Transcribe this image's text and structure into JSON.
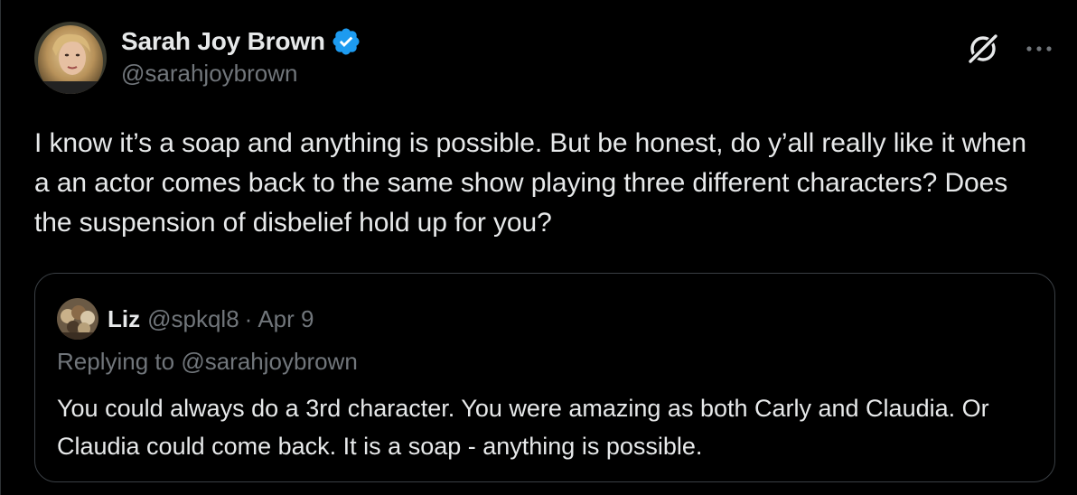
{
  "author": {
    "display_name": "Sarah Joy Brown",
    "handle": "@sarahjoybrown",
    "verified": true,
    "avatar_icon": "avatar-photo"
  },
  "tweet": {
    "text": "I know it’s a soap and anything is possible. But be honest, do y’all really like it when a an actor comes back to the same show playing three different characters? Does the suspension of disbelief hold up for you?"
  },
  "actions": {
    "grok_icon": "grok-icon",
    "more_icon": "more-icon"
  },
  "quote": {
    "display_name": "Liz",
    "handle": "@spkql8",
    "separator": "·",
    "date": "Apr 9",
    "replying_prefix": "Replying to",
    "replying_to": "@sarahjoybrown",
    "text": "You could always do a 3rd character. You were amazing as both Carly and Claudia. Or Claudia could come back. It is a soap - anything is possible."
  },
  "colors": {
    "background": "#000000",
    "text_primary": "#e7e9ea",
    "text_secondary": "#71767b",
    "verified_blue": "#1d9bf0",
    "border": "#3a3f44"
  }
}
